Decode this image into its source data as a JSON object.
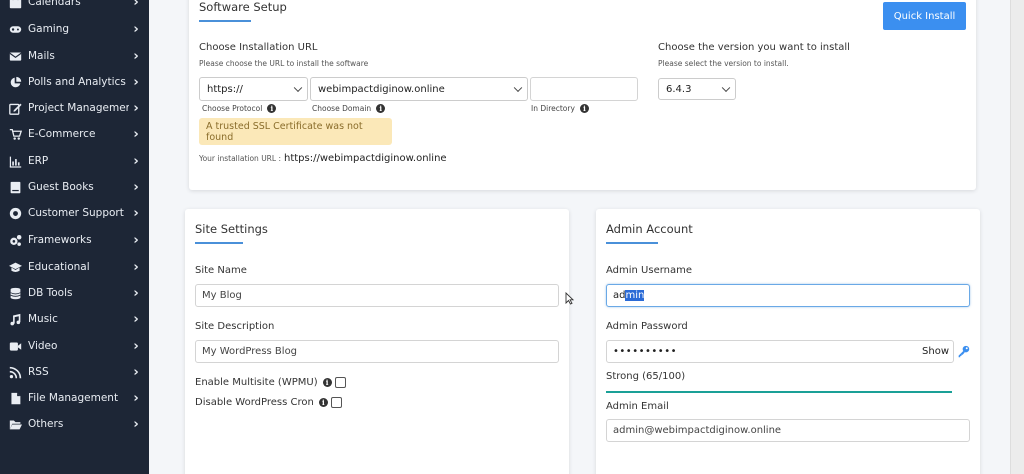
{
  "sidebar": {
    "items": [
      {
        "label": "Calendars",
        "icon": "calendar-icon"
      },
      {
        "label": "Gaming",
        "icon": "gamepad-icon"
      },
      {
        "label": "Mails",
        "icon": "envelope-icon"
      },
      {
        "label": "Polls and Analytics",
        "icon": "pie-chart-icon"
      },
      {
        "label": "Project Management",
        "icon": "edit-icon"
      },
      {
        "label": "E-Commerce",
        "icon": "cart-icon"
      },
      {
        "label": "ERP",
        "icon": "bar-chart-icon"
      },
      {
        "label": "Guest Books",
        "icon": "book-icon"
      },
      {
        "label": "Customer Support",
        "icon": "lifebuoy-icon"
      },
      {
        "label": "Frameworks",
        "icon": "cogs-icon"
      },
      {
        "label": "Educational",
        "icon": "graduation-cap-icon"
      },
      {
        "label": "DB Tools",
        "icon": "database-icon"
      },
      {
        "label": "Music",
        "icon": "music-icon"
      },
      {
        "label": "Video",
        "icon": "video-icon"
      },
      {
        "label": "RSS",
        "icon": "rss-icon"
      },
      {
        "label": "File Management",
        "icon": "file-icon"
      },
      {
        "label": "Others",
        "icon": "folder-open-icon"
      }
    ],
    "chevron": "›"
  },
  "software_setup": {
    "title": "Software Setup",
    "quick_install_label": "Quick Install",
    "install_url_label": "Choose Installation URL",
    "install_url_hint": "Please choose the URL to install the software",
    "version_label": "Choose the version you want to install",
    "version_hint": "Please select the version to install.",
    "protocol_value": "https://",
    "protocol_label": "Choose Protocol",
    "domain_value": "webimpactdiginow.online",
    "domain_label": "Choose Domain",
    "directory_value": "",
    "directory_label": "In Directory",
    "version_value": "6.4.3",
    "ssl_warning": "A trusted SSL Certificate was not found",
    "install_url_prefix": "Your installation URL :",
    "install_url_value": "https://webimpactdiginow.online"
  },
  "site_settings": {
    "title": "Site Settings",
    "site_name_label": "Site Name",
    "site_name_value": "My Blog",
    "site_desc_label": "Site Description",
    "site_desc_value": "My WordPress Blog",
    "multisite_label": "Enable Multisite (WPMU)",
    "cron_label": "Disable WordPress Cron"
  },
  "admin_account": {
    "title": "Admin Account",
    "username_label": "Admin Username",
    "username_value_plain": "ad",
    "username_value_selected": "min",
    "password_label": "Admin Password",
    "password_value": "••••••••••",
    "show_label": "Show",
    "strength_label": "Strong (65/100)",
    "strength_percent": 65,
    "email_label": "Admin Email",
    "email_value": "admin@webimpactdiginow.online"
  },
  "colors": {
    "sidebar_bg": "#1d2636",
    "primary": "#3b8ff0",
    "warning_bg": "#fbe8b8",
    "strength_bar": "#1aa097"
  }
}
